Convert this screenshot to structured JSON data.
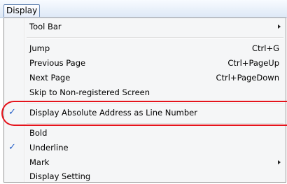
{
  "menubar": {
    "title": "Display"
  },
  "menu": {
    "tool_bar": "Tool Bar",
    "jump": {
      "label": "Jump",
      "shortcut": "Ctrl+G"
    },
    "previous_page": {
      "label": "Previous Page",
      "shortcut": "Ctrl+PageUp"
    },
    "next_page": {
      "label": "Next Page",
      "shortcut": "Ctrl+PageDown"
    },
    "skip": "Skip to Non-registered Screen",
    "display_absolute": {
      "label": "Display Absolute Address as Line Number",
      "checked": true
    },
    "bold": "Bold",
    "underline": {
      "label": "Underline",
      "checked": true
    },
    "mark": "Mark",
    "display_setting": "Display Setting"
  },
  "colors": {
    "check": "#2a63c8",
    "highlight": "#e5141c",
    "menu_bg": "#f5f6f7"
  },
  "check_glyph": "✓"
}
